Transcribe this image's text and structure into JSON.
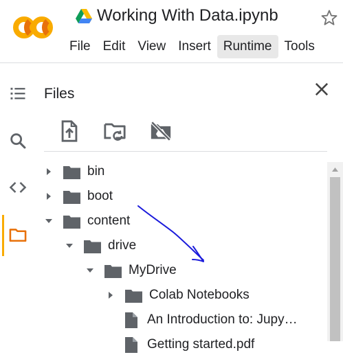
{
  "header": {
    "logo_text": "CO",
    "logo_colors": [
      "#F9AB00",
      "#E8710A"
    ],
    "drive_icon": "google-drive-icon",
    "notebook_title": "Working With Data.ipynb",
    "star_icon": "star-outline-icon"
  },
  "menu": {
    "items": [
      {
        "label": "File"
      },
      {
        "label": "Edit"
      },
      {
        "label": "View"
      },
      {
        "label": "Insert"
      },
      {
        "label": "Runtime",
        "active": true
      },
      {
        "label": "Tools"
      }
    ]
  },
  "rail": {
    "icons": [
      "table-of-contents-icon",
      "search-icon",
      "code-snippets-icon",
      "files-folder-icon"
    ],
    "active": "files-folder-icon",
    "accent_color": "#F9AB00"
  },
  "files_panel": {
    "title": "Files",
    "close_icon": "close-icon",
    "toolbar": [
      "upload-file-icon",
      "refresh-folder-icon",
      "unmount-drive-icon"
    ],
    "tree": [
      {
        "label": "bin",
        "type": "folder",
        "depth": 0,
        "expanded": false
      },
      {
        "label": "boot",
        "type": "folder",
        "depth": 0,
        "expanded": false
      },
      {
        "label": "content",
        "type": "folder",
        "depth": 0,
        "expanded": true
      },
      {
        "label": "drive",
        "type": "folder",
        "depth": 1,
        "expanded": true
      },
      {
        "label": "MyDrive",
        "type": "folder",
        "depth": 2,
        "expanded": true
      },
      {
        "label": "Colab Notebooks",
        "type": "folder",
        "depth": 3,
        "expanded": false
      },
      {
        "label": "An Introduction to: Jupy…",
        "type": "file",
        "depth": 3
      },
      {
        "label": "Getting started.pdf",
        "type": "file",
        "depth": 3
      }
    ]
  },
  "annotation": {
    "type": "hand-drawn-arrow",
    "color": "#1a1adb"
  }
}
